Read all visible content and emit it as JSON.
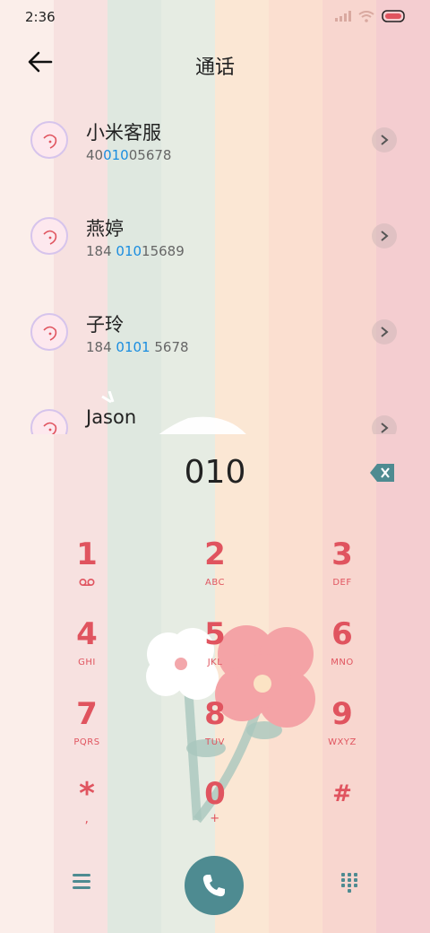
{
  "status_bar": {
    "time": "2:36"
  },
  "header": {
    "title": "通话"
  },
  "contacts": [
    {
      "name": "小米客服",
      "number_pre": "40",
      "number_match": "010",
      "number_post": "05678"
    },
    {
      "name": "燕婷",
      "number_pre": "184 ",
      "number_match": "010",
      "number_post": "15689"
    },
    {
      "name": "子玲",
      "number_pre": "184 ",
      "number_match": "0101",
      "number_post": " 5678"
    },
    {
      "name": "Jason",
      "number_pre": "",
      "number_match": "",
      "number_post": ""
    }
  ],
  "dialer": {
    "input_value": "010",
    "keys": [
      {
        "digit": "1",
        "letters": ""
      },
      {
        "digit": "2",
        "letters": "ABC"
      },
      {
        "digit": "3",
        "letters": "DEF"
      },
      {
        "digit": "4",
        "letters": "GHI"
      },
      {
        "digit": "5",
        "letters": "JKL"
      },
      {
        "digit": "6",
        "letters": "MNO"
      },
      {
        "digit": "7",
        "letters": "PQRS"
      },
      {
        "digit": "8",
        "letters": "TUV"
      },
      {
        "digit": "9",
        "letters": "WXYZ"
      },
      {
        "digit": "*",
        "letters": ","
      },
      {
        "digit": "0",
        "letters": "+"
      },
      {
        "digit": "#",
        "letters": ""
      }
    ]
  },
  "colors": {
    "accent": "#e0545f",
    "call_button": "#4e8b91",
    "highlight": "#1a8de0"
  },
  "icons": [
    "back-arrow-icon",
    "signal-icon",
    "wifi-icon",
    "battery-icon",
    "chevron-right-icon",
    "backspace-icon",
    "voicemail-icon",
    "menu-icon",
    "phone-icon",
    "dialpad-icon"
  ]
}
